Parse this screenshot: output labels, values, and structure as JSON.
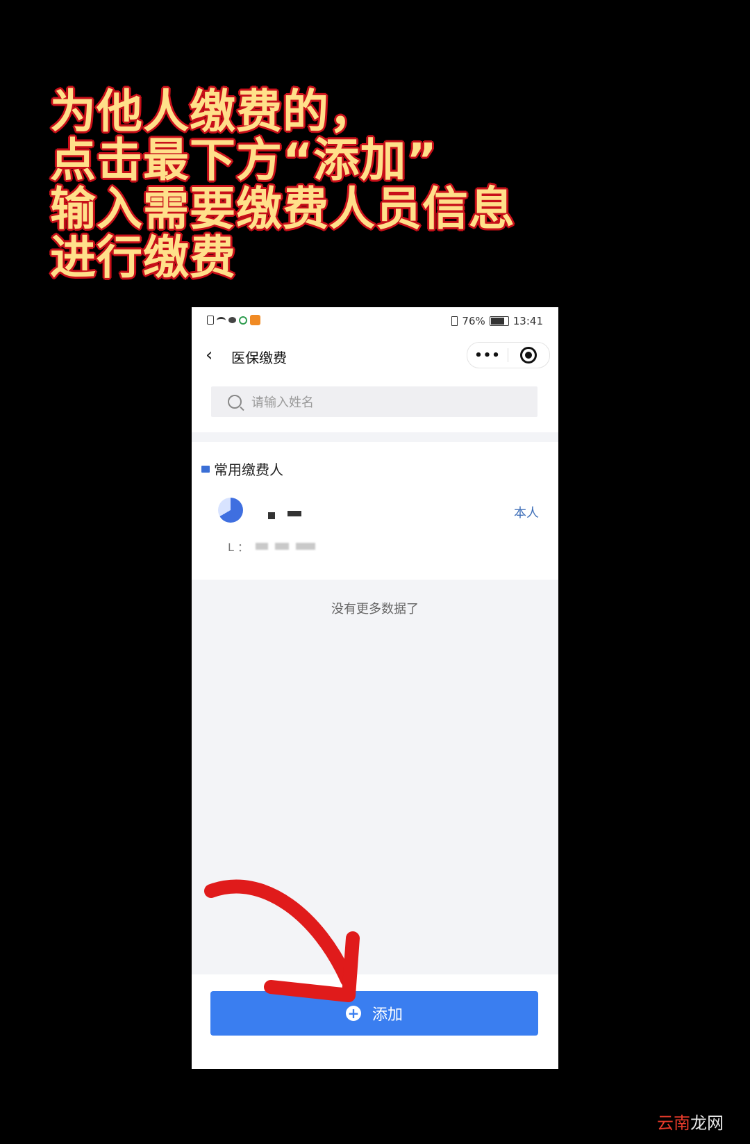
{
  "caption": {
    "line1": "为他人缴费的，",
    "line2": "点击最下方“添加”",
    "line3": "输入需要缴费人员信息",
    "line4": "进行缴费"
  },
  "status_bar": {
    "battery": "76%",
    "time": "13:41"
  },
  "nav": {
    "back_icon": "‹",
    "title": "医保缴费",
    "more": "•••"
  },
  "search": {
    "placeholder": "请输入姓名"
  },
  "section": {
    "title": "常用缴费人"
  },
  "person": {
    "tag": "本人",
    "id_prefix": "L ："
  },
  "list_end": "没有更多数据了",
  "add_button": {
    "icon": "+",
    "label": "添加"
  },
  "watermark": {
    "part1": "云南",
    "part2": "龙网"
  },
  "colors": {
    "primary": "#3a7ef0",
    "caption_text": "#ffe08a",
    "caption_outline": "#c8101a",
    "arrow": "#e01b1b",
    "tag_blue": "#3f6fb8"
  }
}
